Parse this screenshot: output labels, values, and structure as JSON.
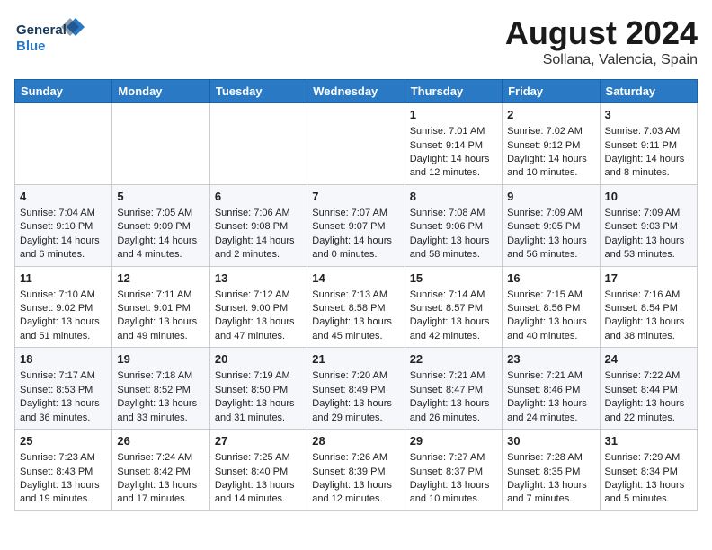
{
  "header": {
    "logo_line1": "General",
    "logo_line2": "Blue",
    "month": "August 2024",
    "location": "Sollana, Valencia, Spain"
  },
  "days_of_week": [
    "Sunday",
    "Monday",
    "Tuesday",
    "Wednesday",
    "Thursday",
    "Friday",
    "Saturday"
  ],
  "weeks": [
    [
      {
        "day": "",
        "data": ""
      },
      {
        "day": "",
        "data": ""
      },
      {
        "day": "",
        "data": ""
      },
      {
        "day": "",
        "data": ""
      },
      {
        "day": "1",
        "data": "Sunrise: 7:01 AM\nSunset: 9:14 PM\nDaylight: 14 hours\nand 12 minutes."
      },
      {
        "day": "2",
        "data": "Sunrise: 7:02 AM\nSunset: 9:12 PM\nDaylight: 14 hours\nand 10 minutes."
      },
      {
        "day": "3",
        "data": "Sunrise: 7:03 AM\nSunset: 9:11 PM\nDaylight: 14 hours\nand 8 minutes."
      }
    ],
    [
      {
        "day": "4",
        "data": "Sunrise: 7:04 AM\nSunset: 9:10 PM\nDaylight: 14 hours\nand 6 minutes."
      },
      {
        "day": "5",
        "data": "Sunrise: 7:05 AM\nSunset: 9:09 PM\nDaylight: 14 hours\nand 4 minutes."
      },
      {
        "day": "6",
        "data": "Sunrise: 7:06 AM\nSunset: 9:08 PM\nDaylight: 14 hours\nand 2 minutes."
      },
      {
        "day": "7",
        "data": "Sunrise: 7:07 AM\nSunset: 9:07 PM\nDaylight: 14 hours\nand 0 minutes."
      },
      {
        "day": "8",
        "data": "Sunrise: 7:08 AM\nSunset: 9:06 PM\nDaylight: 13 hours\nand 58 minutes."
      },
      {
        "day": "9",
        "data": "Sunrise: 7:09 AM\nSunset: 9:05 PM\nDaylight: 13 hours\nand 56 minutes."
      },
      {
        "day": "10",
        "data": "Sunrise: 7:09 AM\nSunset: 9:03 PM\nDaylight: 13 hours\nand 53 minutes."
      }
    ],
    [
      {
        "day": "11",
        "data": "Sunrise: 7:10 AM\nSunset: 9:02 PM\nDaylight: 13 hours\nand 51 minutes."
      },
      {
        "day": "12",
        "data": "Sunrise: 7:11 AM\nSunset: 9:01 PM\nDaylight: 13 hours\nand 49 minutes."
      },
      {
        "day": "13",
        "data": "Sunrise: 7:12 AM\nSunset: 9:00 PM\nDaylight: 13 hours\nand 47 minutes."
      },
      {
        "day": "14",
        "data": "Sunrise: 7:13 AM\nSunset: 8:58 PM\nDaylight: 13 hours\nand 45 minutes."
      },
      {
        "day": "15",
        "data": "Sunrise: 7:14 AM\nSunset: 8:57 PM\nDaylight: 13 hours\nand 42 minutes."
      },
      {
        "day": "16",
        "data": "Sunrise: 7:15 AM\nSunset: 8:56 PM\nDaylight: 13 hours\nand 40 minutes."
      },
      {
        "day": "17",
        "data": "Sunrise: 7:16 AM\nSunset: 8:54 PM\nDaylight: 13 hours\nand 38 minutes."
      }
    ],
    [
      {
        "day": "18",
        "data": "Sunrise: 7:17 AM\nSunset: 8:53 PM\nDaylight: 13 hours\nand 36 minutes."
      },
      {
        "day": "19",
        "data": "Sunrise: 7:18 AM\nSunset: 8:52 PM\nDaylight: 13 hours\nand 33 minutes."
      },
      {
        "day": "20",
        "data": "Sunrise: 7:19 AM\nSunset: 8:50 PM\nDaylight: 13 hours\nand 31 minutes."
      },
      {
        "day": "21",
        "data": "Sunrise: 7:20 AM\nSunset: 8:49 PM\nDaylight: 13 hours\nand 29 minutes."
      },
      {
        "day": "22",
        "data": "Sunrise: 7:21 AM\nSunset: 8:47 PM\nDaylight: 13 hours\nand 26 minutes."
      },
      {
        "day": "23",
        "data": "Sunrise: 7:21 AM\nSunset: 8:46 PM\nDaylight: 13 hours\nand 24 minutes."
      },
      {
        "day": "24",
        "data": "Sunrise: 7:22 AM\nSunset: 8:44 PM\nDaylight: 13 hours\nand 22 minutes."
      }
    ],
    [
      {
        "day": "25",
        "data": "Sunrise: 7:23 AM\nSunset: 8:43 PM\nDaylight: 13 hours\nand 19 minutes."
      },
      {
        "day": "26",
        "data": "Sunrise: 7:24 AM\nSunset: 8:42 PM\nDaylight: 13 hours\nand 17 minutes."
      },
      {
        "day": "27",
        "data": "Sunrise: 7:25 AM\nSunset: 8:40 PM\nDaylight: 13 hours\nand 14 minutes."
      },
      {
        "day": "28",
        "data": "Sunrise: 7:26 AM\nSunset: 8:39 PM\nDaylight: 13 hours\nand 12 minutes."
      },
      {
        "day": "29",
        "data": "Sunrise: 7:27 AM\nSunset: 8:37 PM\nDaylight: 13 hours\nand 10 minutes."
      },
      {
        "day": "30",
        "data": "Sunrise: 7:28 AM\nSunset: 8:35 PM\nDaylight: 13 hours\nand 7 minutes."
      },
      {
        "day": "31",
        "data": "Sunrise: 7:29 AM\nSunset: 8:34 PM\nDaylight: 13 hours\nand 5 minutes."
      }
    ]
  ]
}
